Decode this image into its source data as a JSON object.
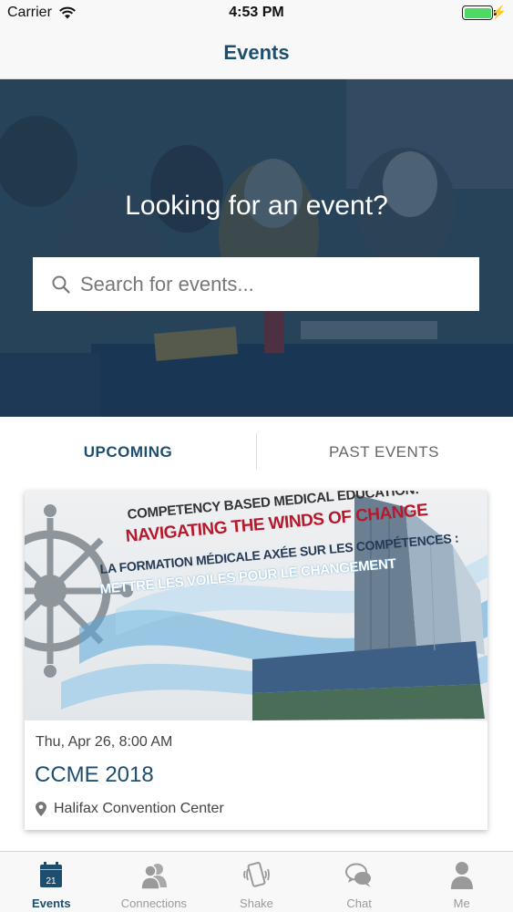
{
  "status_bar": {
    "carrier": "Carrier",
    "time": "4:53 PM"
  },
  "nav": {
    "title": "Events"
  },
  "hero": {
    "title": "Looking for an event?",
    "search_placeholder": "Search for events..."
  },
  "tabs": {
    "upcoming": "UPCOMING",
    "past": "PAST EVENTS"
  },
  "event": {
    "banner": {
      "line1": "COMPETENCY BASED MEDICAL EDUCATION:",
      "line2": "NAVIGATING THE WINDS OF CHANGE",
      "line3": "LA FORMATION MÉDICALE AXÉE SUR LES COMPÉTENCES :",
      "line4": "METTRE LES VOILES POUR LE CHANGEMENT"
    },
    "date": "Thu, Apr 26, 8:00 AM",
    "name": "CCME 2018",
    "location": "Halifax Convention Center"
  },
  "tab_bar": {
    "events_day": "21",
    "items": [
      {
        "label": "Events",
        "icon": "calendar-icon"
      },
      {
        "label": "Connections",
        "icon": "people-icon"
      },
      {
        "label": "Shake",
        "icon": "shake-phone-icon"
      },
      {
        "label": "Chat",
        "icon": "chat-bubbles-icon"
      },
      {
        "label": "Me",
        "icon": "person-icon"
      }
    ]
  },
  "colors": {
    "accent": "#1e4e6e",
    "inactive": "#9a9a9a",
    "battery": "#4cd964"
  }
}
